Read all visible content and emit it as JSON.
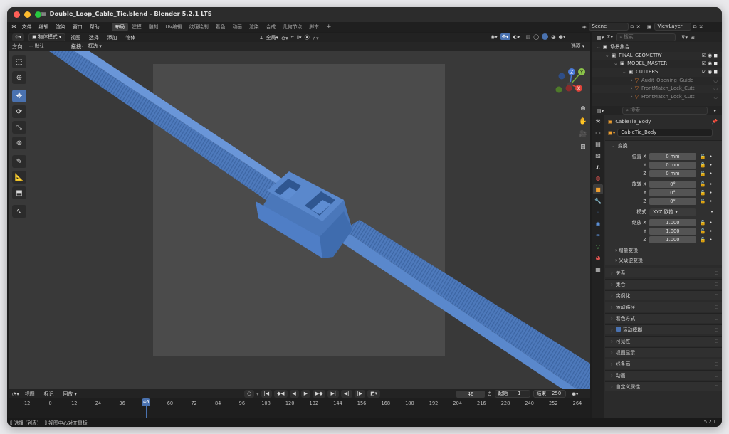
{
  "window": {
    "title": "Double_Loop_Cable_Tie.blend - Blender 5.2.1 LTS",
    "version": "5.2.1"
  },
  "colors": {
    "accent": "#4a72b0",
    "object_blue": "#4f7ec6",
    "playhead": "#4a72b0",
    "traffic_close": "#fe5f57",
    "traffic_min": "#febc2e",
    "traffic_max": "#28c840"
  },
  "menu": [
    "文件",
    "编辑",
    "渲染",
    "窗口",
    "帮助"
  ],
  "workspaces": [
    "布局",
    "建模",
    "雕刻",
    "UV编辑",
    "纹理绘制",
    "着色",
    "动画",
    "渲染",
    "合成",
    "几何节点",
    "脚本"
  ],
  "active_workspace": "布局",
  "scene": {
    "label": "Scene",
    "view_layer": "ViewLayer"
  },
  "viewport_header": {
    "mode": "物体模式",
    "menus": [
      "视图",
      "选择",
      "添加",
      "物体"
    ],
    "orientation_label": "全局",
    "options": "选项"
  },
  "tool_settings": {
    "direction_label": "方向:",
    "direction_value": "默认",
    "drag_label": "拖拽:",
    "drag_value": "框选"
  },
  "outliner": {
    "search_placeholder": "搜索",
    "rows": [
      {
        "name": "场景集合",
        "indent": 0
      },
      {
        "name": "FINAL_GEOMETRY",
        "indent": 1
      },
      {
        "name": "MODEL_MASTER",
        "indent": 2
      },
      {
        "name": "CUTTERS",
        "indent": 3
      },
      {
        "name": "Audit_Opening_Guide",
        "indent": 4
      },
      {
        "name": "FrontMatch_Lock_Cutt",
        "indent": 4
      },
      {
        "name": "FrontMatch_Lock_Cutt",
        "indent": 4
      }
    ]
  },
  "properties": {
    "search_placeholder": "搜索",
    "object_name": "CableTie_Body",
    "object_field": "CableTie_Body",
    "transform": {
      "title": "变换",
      "location_label": "位置 X",
      "location": [
        "0 mm",
        "0 mm",
        "0 mm"
      ],
      "rotation_label": "旋转 X",
      "rotation": [
        "0°",
        "0°",
        "0°"
      ],
      "mode_label": "模式",
      "mode_value": "XYZ 欧拉",
      "scale_label": "缩放 X",
      "scale": [
        "1.000",
        "1.000",
        "1.000"
      ],
      "y": "Y",
      "z": "Z",
      "delta": "增量变换",
      "parent_inverse": "父级逆变换"
    },
    "panels": [
      "关系",
      "集合",
      "实例化",
      "运动路径",
      "着色方式",
      "运动模糊",
      "可见性",
      "视图显示",
      "线条画",
      "动画",
      "自定义属性"
    ]
  },
  "timeline": {
    "menus": [
      "视图",
      "标记",
      "回放"
    ],
    "current_frame": "46",
    "start_label": "起始",
    "start": "1",
    "end_label": "结束",
    "end": "250",
    "ticks": [
      "-12",
      "0",
      "12",
      "24",
      "36",
      "46",
      "60",
      "72",
      "84",
      "96",
      "108",
      "120",
      "132",
      "144",
      "156",
      "168",
      "180",
      "192",
      "204",
      "216",
      "228",
      "240",
      "252",
      "264"
    ]
  },
  "status": {
    "select": "选择 (列表)",
    "center": "视图中心对齐鼠标"
  }
}
